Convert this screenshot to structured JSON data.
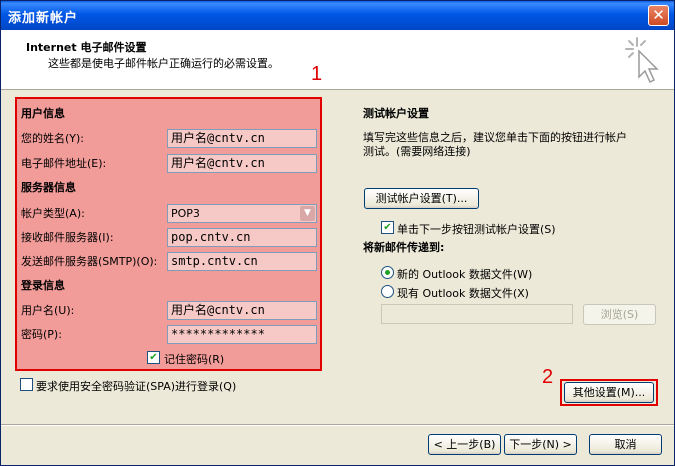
{
  "window": {
    "title": "添加新帐户",
    "close_label": "✕"
  },
  "header": {
    "title": "Internet 电子邮件设置",
    "subtitle": "这些都是使电子邮件帐户正确运行的必需设置。"
  },
  "annotations": {
    "label_1": "1",
    "label_2": "2"
  },
  "user_info": {
    "section": "用户信息",
    "name_label": "您的姓名(Y):",
    "name_value": "用户名@cntv.cn",
    "email_label": "电子邮件地址(E):",
    "email_value": "用户名@cntv.cn"
  },
  "server_info": {
    "section": "服务器信息",
    "account_type_label": "帐户类型(A):",
    "account_type_value": "POP3",
    "incoming_label": "接收邮件服务器(I):",
    "incoming_value": "pop.cntv.cn",
    "outgoing_label": "发送邮件服务器(SMTP)(O):",
    "outgoing_value": "smtp.cntv.cn"
  },
  "login_info": {
    "section": "登录信息",
    "username_label": "用户名(U):",
    "username_value": "用户名@cntv.cn",
    "password_label": "密码(P):",
    "password_value": "*************",
    "remember_label": "记住密码(R)",
    "remember_checked": true
  },
  "spa": {
    "label": "要求使用安全密码验证(SPA)进行登录(Q)",
    "checked": false
  },
  "test": {
    "title": "测试帐户设置",
    "desc_line1": "填写完这些信息之后，建议您单击下面的按钮进行帐户",
    "desc_line2": "测试。(需要网络连接)",
    "button": "测试帐户设置(T)...",
    "auto_test_label": "单击下一步按钮测试帐户设置(S)",
    "auto_test_checked": true
  },
  "deliver": {
    "title": "将新邮件传递到:",
    "option_new": "新的 Outlook 数据文件(W)",
    "option_existing": "现有 Outlook 数据文件(X)",
    "selected": "new",
    "browse": "浏览(S)"
  },
  "buttons": {
    "more_settings": "其他设置(M)...",
    "back": "< 上一步(B)",
    "next": "下一步(N) >",
    "cancel": "取消"
  }
}
